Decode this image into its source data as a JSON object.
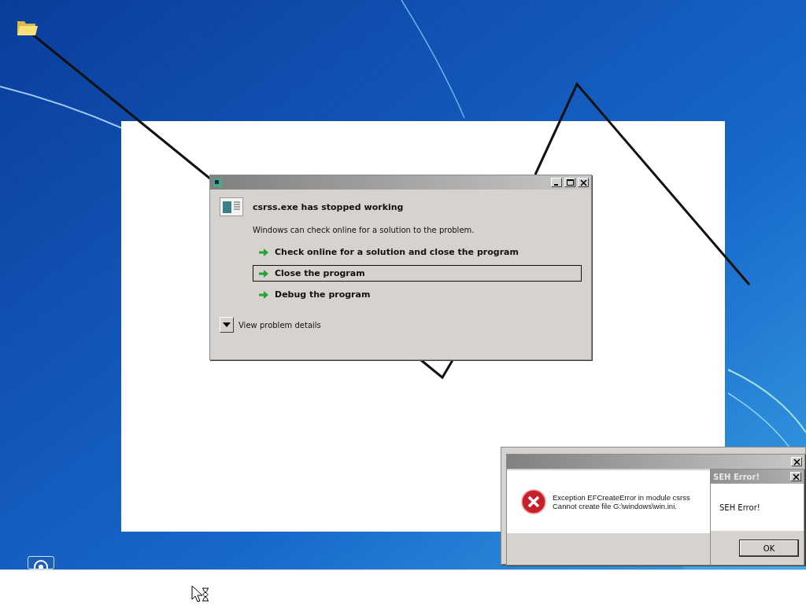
{
  "error_dialog": {
    "heading": "csrss.exe has stopped working",
    "message": "Windows can check online for a solution to the problem.",
    "options": [
      {
        "label": "Check online for a solution and close the program",
        "selected": false
      },
      {
        "label": "Close the program",
        "selected": true
      },
      {
        "label": "Debug the program",
        "selected": false
      }
    ],
    "details_toggle": "View problem details"
  },
  "exception_dialog": {
    "message_lines": [
      "Exception EFCreateError in module csrss",
      "Cannot create file G:\\windows\\win.ini."
    ]
  },
  "seh_dialog": {
    "title": "SEH Error!",
    "message": "SEH Error!",
    "button": "OK"
  }
}
